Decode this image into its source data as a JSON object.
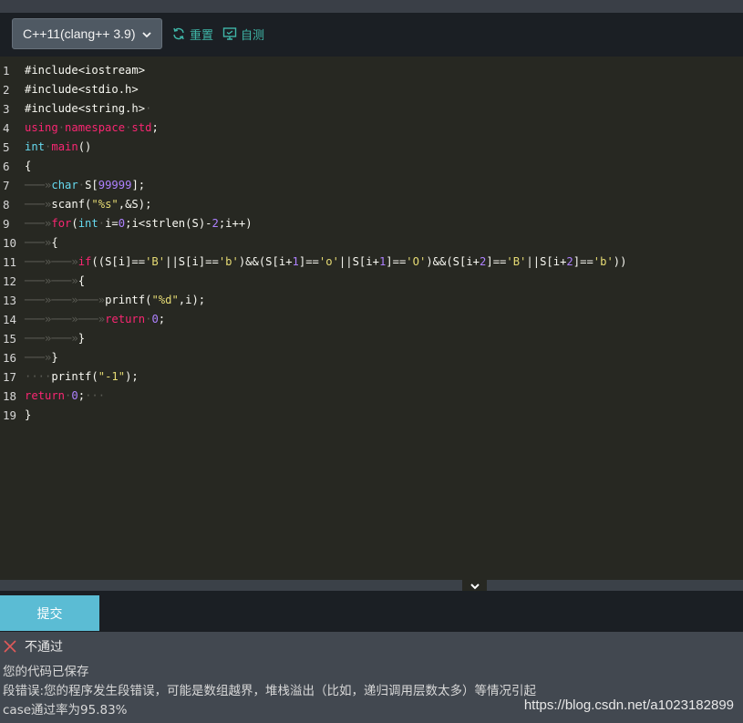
{
  "toolbar": {
    "language": "C++11(clang++ 3.9)",
    "reset_label": "重置",
    "selftest_label": "自测"
  },
  "editor": {
    "lines": [
      {
        "n": "1",
        "html": "#include&lt;iostream&gt;"
      },
      {
        "n": "2",
        "html": "#include&lt;stdio.h&gt;"
      },
      {
        "n": "3",
        "html": "#include&lt;string.h&gt;<span class=\"ws\">·</span>"
      },
      {
        "n": "4",
        "html": "<span class=\"kw\">using</span><span class=\"ws\">·</span><span class=\"kw\">namespace</span><span class=\"ws\">·</span><span class=\"kw\">std</span>;"
      },
      {
        "n": "5",
        "html": "<span class=\"ty\">int</span><span class=\"ws\">·</span><span class=\"kw\">main</span>()"
      },
      {
        "n": "6",
        "html": "{"
      },
      {
        "n": "7",
        "html": "<span class=\"ws\">───»</span><span class=\"ty\">char</span><span class=\"ws\">·</span>S[<span class=\"num\">99999</span>];"
      },
      {
        "n": "8",
        "html": "<span class=\"ws\">───»</span>scanf(<span class=\"str\">\"%s\"</span>,&amp;S);"
      },
      {
        "n": "9",
        "html": "<span class=\"ws\">───»</span><span class=\"kw\">for</span>(<span class=\"ty\">int</span><span class=\"ws\">·</span>i=<span class=\"num\">0</span>;i&lt;strlen(S)-<span class=\"num\">2</span>;i++)"
      },
      {
        "n": "10",
        "html": "<span class=\"ws\">───»</span>{"
      },
      {
        "n": "11",
        "html": "<span class=\"ws\">───»───»</span><span class=\"kw\">if</span>((S[i]==<span class=\"str\">'B'</span>||S[i]==<span class=\"str\">'b'</span>)&amp;&amp;(S[i+<span class=\"num\">1</span>]==<span class=\"str\">'o'</span>||S[i+<span class=\"num\">1</span>]==<span class=\"str\">'O'</span>)&amp;&amp;(S[i+<span class=\"num\">2</span>]==<span class=\"str\">'B'</span>||S[i+<span class=\"num\">2</span>]==<span class=\"str\">'b'</span>))"
      },
      {
        "n": "12",
        "html": "<span class=\"ws\">───»───»</span>{"
      },
      {
        "n": "13",
        "html": "<span class=\"ws\">───»───»───»</span>printf(<span class=\"str\">\"%d\"</span>,i);"
      },
      {
        "n": "14",
        "html": "<span class=\"ws\">───»───»───»</span><span class=\"kw\">return</span><span class=\"ws\">·</span><span class=\"num\">0</span>;"
      },
      {
        "n": "15",
        "html": "<span class=\"ws\">───»───»</span>}"
      },
      {
        "n": "16",
        "html": "<span class=\"ws\">───»</span>}"
      },
      {
        "n": "17",
        "html": "<span class=\"ws\">····</span>printf(<span class=\"str\">\"-1\"</span>);"
      },
      {
        "n": "18",
        "html": "<span class=\"kw\">return</span><span class=\"ws\">·</span><span class=\"num\">0</span>;<span class=\"ws\">···</span>"
      },
      {
        "n": "19",
        "html": "}"
      }
    ]
  },
  "submit": {
    "label": "提交"
  },
  "result": {
    "status": "不通过",
    "saved": "您的代码已保存",
    "error": "段错误:您的程序发生段错误，可能是数组越界，堆栈溢出（比如，递归调用层数太多）等情况引起",
    "pass_rate": "case通过率为95.83%",
    "watermark": "https://blog.csdn.net/a1023182899"
  },
  "colors": {
    "accent": "#3fb6a8",
    "submit": "#5bbcd4",
    "fail": "#e05a5a"
  }
}
